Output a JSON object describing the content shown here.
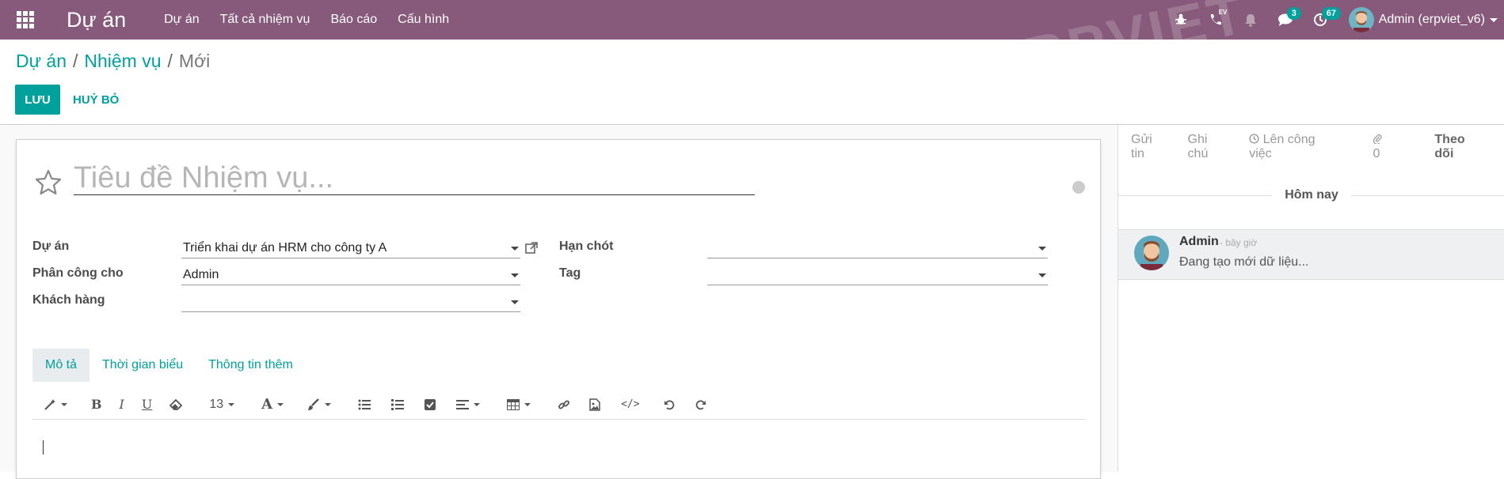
{
  "navbar": {
    "app_title": "Dự án",
    "menu": [
      "Dự án",
      "Tất cả nhiệm vụ",
      "Báo cáo",
      "Cấu hình"
    ],
    "ev_label": "EV",
    "messages_count": "3",
    "activities_count": "67",
    "user_name": "Admin (erpviet_v6)"
  },
  "breadcrumb": {
    "project": "Dự án",
    "tasks": "Nhiệm vụ",
    "current": "Mới",
    "sep": "/"
  },
  "buttons": {
    "save": "LƯU",
    "discard": "HUỶ BỎ"
  },
  "form": {
    "title_placeholder": "Tiêu đề Nhiệm vụ...",
    "fields": {
      "project_label": "Dự án",
      "project_value": "Triển khai dự án HRM cho công ty A",
      "assignee_label": "Phân công cho",
      "assignee_value": "Admin",
      "customer_label": "Khách hàng",
      "customer_value": "",
      "deadline_label": "Hạn chót",
      "deadline_value": "",
      "tag_label": "Tag",
      "tag_value": ""
    },
    "tabs": [
      "Mô tả",
      "Thời gian biểu",
      "Thông tin thêm"
    ],
    "toolbar": {
      "font_size": "13",
      "font_color": "A"
    }
  },
  "chatter": {
    "send_message": "Gửi tin",
    "log_note": "Ghi chú",
    "schedule_activity": "Lên công việc",
    "attachments": "0",
    "follow": "Theo dõi",
    "date_separator": "Hôm nay",
    "message": {
      "author": "Admin",
      "date": "- bây giờ",
      "body": "Đang tạo mới dữ liệu..."
    }
  },
  "colors": {
    "navbar": "#875a7b",
    "primary": "#00a09d"
  }
}
